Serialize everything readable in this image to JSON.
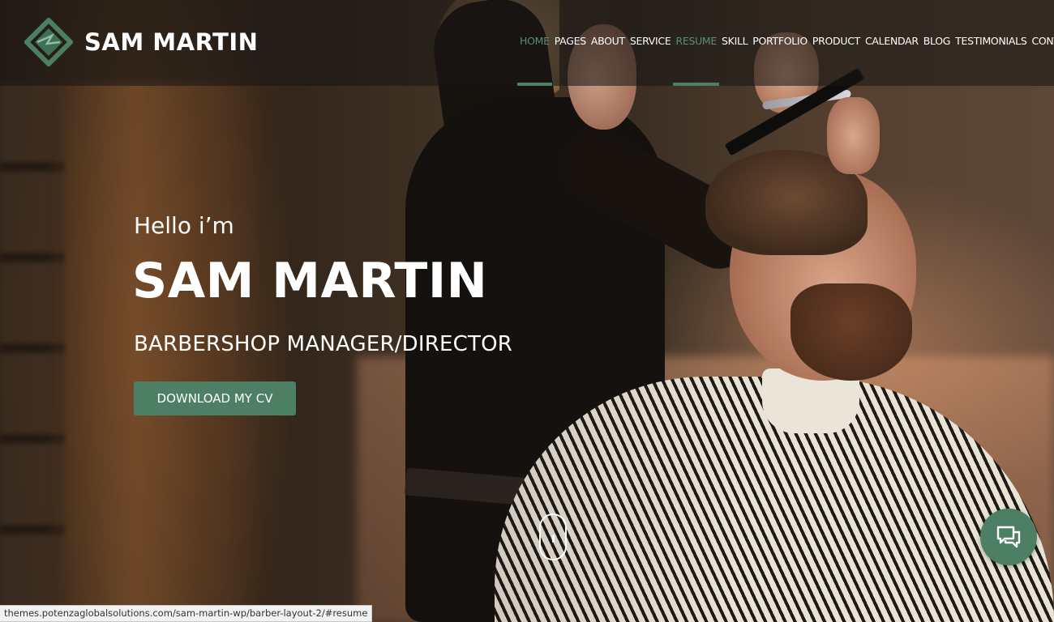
{
  "header": {
    "logo_text": "SAM MARTIN",
    "logo_icon": "diamond-logo-icon",
    "nav": [
      {
        "label": "HOME",
        "active": true
      },
      {
        "label": "PAGES",
        "active": false
      },
      {
        "label": "ABOUT",
        "active": false
      },
      {
        "label": "SERVICE",
        "active": false
      },
      {
        "label": "RESUME",
        "active": true
      },
      {
        "label": "SKILL",
        "active": false
      },
      {
        "label": "PORTFOLIO",
        "active": false
      },
      {
        "label": "PRODUCT",
        "active": false
      },
      {
        "label": "CALENDAR",
        "active": false
      },
      {
        "label": "BLOG",
        "active": false
      },
      {
        "label": "TESTIMONIALS",
        "active": false
      },
      {
        "label": "CONTACT",
        "active": false
      }
    ]
  },
  "hero": {
    "greeting": "Hello i’m",
    "name": "SAM MARTIN",
    "role": "BARBERSHOP MANAGER/DIRECTOR",
    "cta_label": "DOWNLOAD MY CV"
  },
  "scroll_indicator_icon": "mouse-scroll-icon",
  "chat_icon": "chat-bubbles-icon",
  "status_bar_url": "themes.potenzaglobalsolutions.com/sam-martin-wp/barber-layout-2/#resume",
  "colors": {
    "accent": "#4d7f64",
    "nav_active_text": "#5a8e6f",
    "header_overlay": "#181614"
  }
}
